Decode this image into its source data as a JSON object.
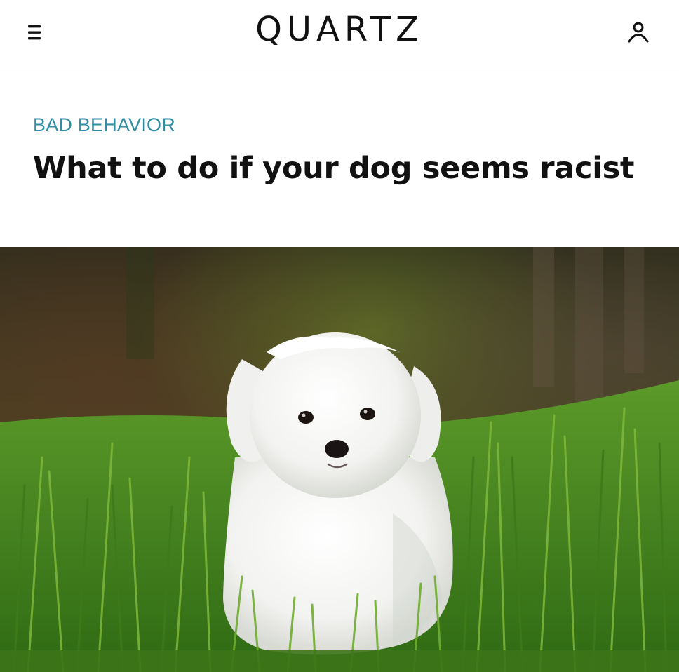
{
  "header": {
    "brand": "QUARTZ",
    "menu_icon": "hamburger-menu-icon",
    "account_icon": "user-account-icon"
  },
  "article": {
    "category": "BAD BEHAVIOR",
    "headline": "What to do if your dog seems racist",
    "image_subject": "small white fluffy puppy sitting in green grass"
  },
  "colors": {
    "category": "#2f8ea2",
    "text": "#111111",
    "background": "#ffffff",
    "grass": "#4e8a22"
  }
}
